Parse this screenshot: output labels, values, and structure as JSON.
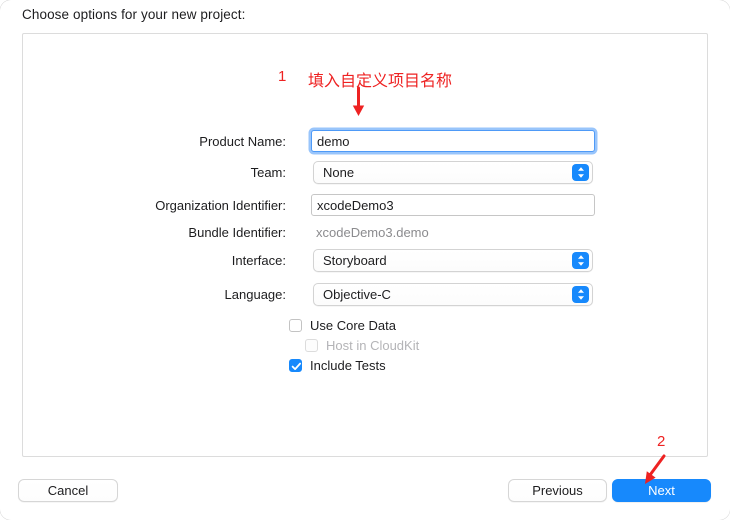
{
  "dialog": {
    "heading": "Choose options for your new project:"
  },
  "form": {
    "fields": [
      {
        "label": "Product Name:",
        "value": "demo",
        "type": "textfield",
        "focused": true
      },
      {
        "label": "Team:",
        "value": "None",
        "type": "popup"
      },
      {
        "label": "Organization Identifier:",
        "value": "xcodeDemo3",
        "type": "textfield",
        "focused": false
      },
      {
        "label": "Bundle Identifier:",
        "value": "xcodeDemo3.demo",
        "type": "static"
      },
      {
        "label": "Interface:",
        "value": "Storyboard",
        "type": "popup"
      },
      {
        "label": "Language:",
        "value": "Objective-C",
        "type": "popup"
      }
    ]
  },
  "checkboxes": [
    {
      "label": "Use Core Data",
      "checked": false,
      "disabled": false
    },
    {
      "label": "Host in CloudKit",
      "checked": false,
      "disabled": true
    },
    {
      "label": "Include Tests",
      "checked": true,
      "disabled": false
    }
  ],
  "footer": {
    "cancel_label": "Cancel",
    "previous_label": "Previous",
    "next_label": "Next"
  },
  "annotations": {
    "step1_number": "1",
    "step1_text": "填入自定义项目名称",
    "step2_number": "2",
    "color": "#ee2222"
  },
  "colors": {
    "accent": "#1789fc",
    "focus_ring": "#4e9af7",
    "panel_border": "#dcdcdc",
    "text": "#1d1d1f",
    "muted_text": "#8b8b8e"
  }
}
